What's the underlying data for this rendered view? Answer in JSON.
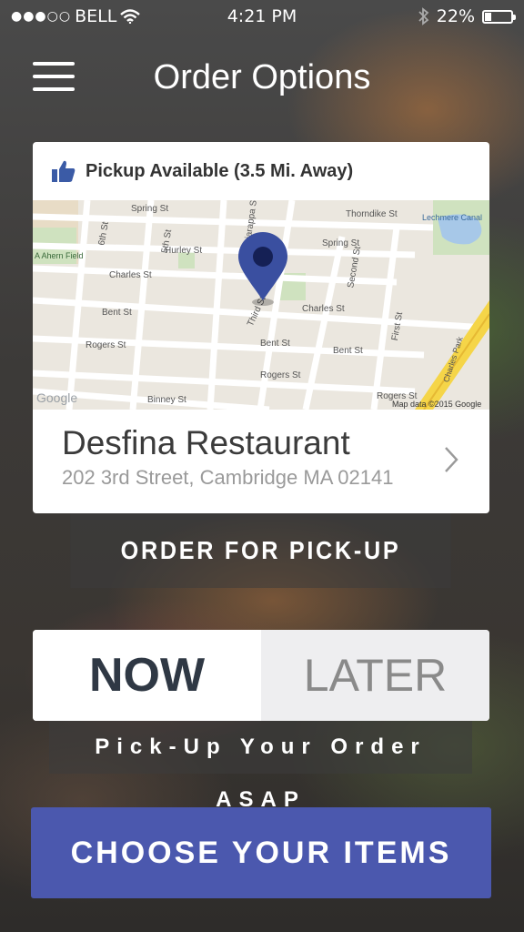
{
  "status_bar": {
    "signal_dots": "●●●○○",
    "carrier": "BELL",
    "time": "4:21 PM",
    "battery_percent": "22%",
    "battery_level": 0.22
  },
  "nav": {
    "title": "Order Options",
    "menu_icon": "hamburger-menu-icon"
  },
  "pickup": {
    "icon": "thumbs-up-icon",
    "label": "Pickup Available (3.5 Mi. Away)"
  },
  "map": {
    "streets": [
      "Spring St",
      "Thorndike St",
      "Hurley St",
      "Charles St",
      "Charles St",
      "Bent St",
      "Bent St",
      "Bent St",
      "Rogers St",
      "Rogers St",
      "Rogers St",
      "Binney St",
      "Spring St",
      "6th St",
      "5th St",
      "Sciarappa St",
      "Third St",
      "Second St",
      "First St",
      "Charles Park",
      "Lechmere Canal",
      "A Ahern Field"
    ],
    "attribution": "Map data ©2015 Google",
    "logo": "Google",
    "pin_icon": "map-pin-icon"
  },
  "restaurant": {
    "name": "Desfina Restaurant",
    "address": "202 3rd Street, Cambridge MA 02141"
  },
  "buttons": {
    "order_pickup": "ORDER FOR PICK-UP",
    "choose_items": "CHOOSE YOUR ITEMS"
  },
  "timing": {
    "now": "NOW",
    "later": "LATER",
    "selected": "NOW",
    "banner": "Pick-Up Your Order ASAP"
  },
  "colors": {
    "accent": "#4b58ae",
    "pin": "#3a4fa0",
    "thumbs": "#3b5ba6"
  }
}
